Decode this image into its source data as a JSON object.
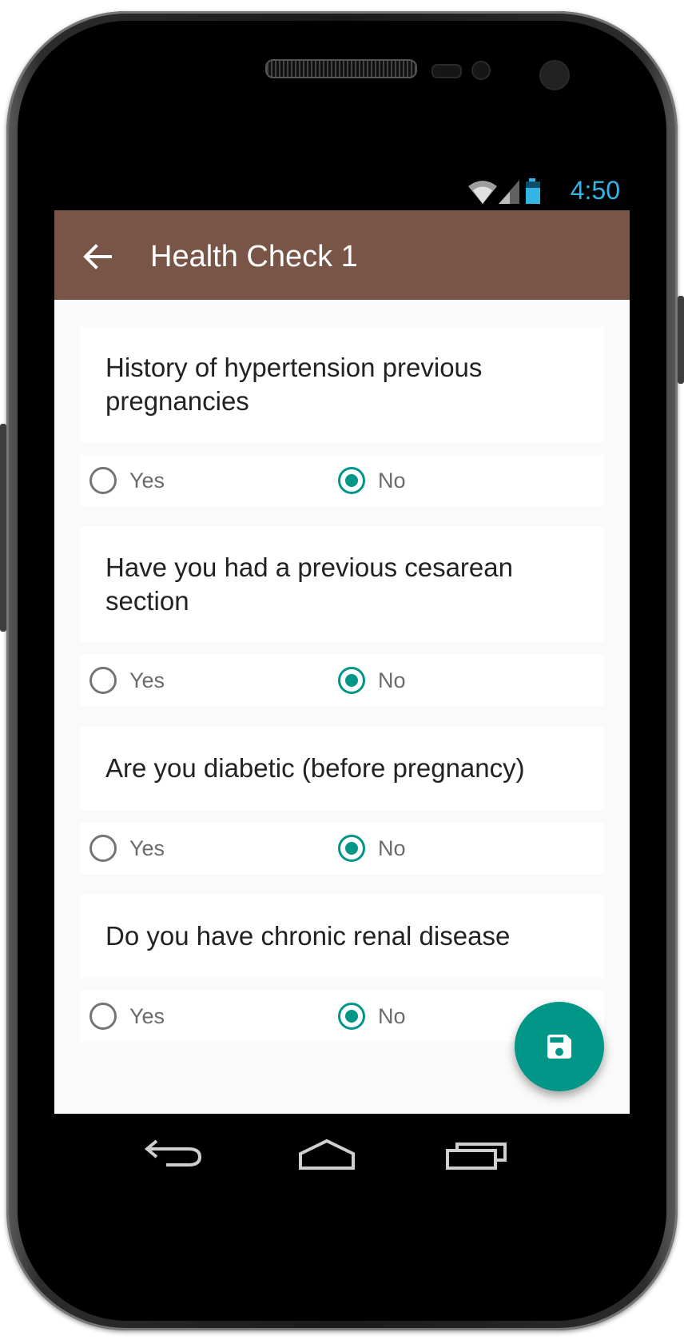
{
  "status_bar": {
    "time": "4:50",
    "icons": [
      "wifi-icon",
      "cell-signal-icon",
      "battery-icon"
    ],
    "time_color": "#33b5e5"
  },
  "app_bar": {
    "title": "Health Check 1",
    "back_icon": "arrow-back-icon",
    "color": "#795548"
  },
  "questions": [
    {
      "text": "History of hypertension previous pregnancies",
      "options": [
        "Yes",
        "No"
      ],
      "selected": "No"
    },
    {
      "text": "Have you had a previous cesarean section",
      "options": [
        "Yes",
        "No"
      ],
      "selected": "No"
    },
    {
      "text": "Are you diabetic (before pregnancy)",
      "options": [
        "Yes",
        "No"
      ],
      "selected": "No"
    },
    {
      "text": "Do you have chronic renal disease",
      "options": [
        "Yes",
        "No"
      ],
      "selected": "No"
    }
  ],
  "fab": {
    "icon": "save-icon",
    "color": "#009688"
  },
  "nav_bar": {
    "icons": [
      "back-nav-icon",
      "home-nav-icon",
      "recents-nav-icon"
    ]
  },
  "accent_color": "#009688"
}
